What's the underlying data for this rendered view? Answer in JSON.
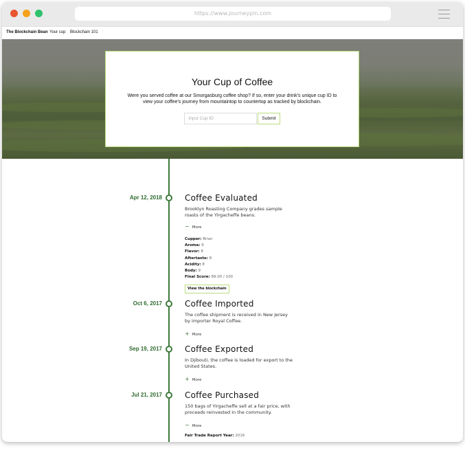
{
  "browser": {
    "url": "https://www.journeypin.com"
  },
  "nav": {
    "brand": "The Blockchain Bean",
    "links": [
      "Your cup",
      "Blockchain 101"
    ]
  },
  "hero": {
    "title": "Your Cup of Coffee",
    "description": "Were you served coffee at our Smorgasburg coffee shop? If so, enter your drink's unique cup ID to view your coffee's journey from mountaintop to countertop as tracked by blockchain.",
    "input_placeholder": "Input Cup ID",
    "submit_label": "Submit"
  },
  "colors": {
    "accent": "#3d7a3b",
    "border_accent": "#b9dc7c"
  },
  "timeline": [
    {
      "date": "Apr 12, 2018",
      "title": "Coffee Evaluated",
      "description": "Brooklyn Roasting Company grades sample roasts of the Yirgacheffe beans.",
      "toggle_sign": "−",
      "toggle_label": "More",
      "details": [
        {
          "key": "Cupper:",
          "value": "Brian"
        },
        {
          "key": "Aroma:",
          "value": "9"
        },
        {
          "key": "Flavor:",
          "value": "8"
        },
        {
          "key": "Aftertaste:",
          "value": "8"
        },
        {
          "key": "Acidity:",
          "value": "8"
        },
        {
          "key": "Body:",
          "value": "9"
        },
        {
          "key": "Final Score:",
          "value": "89.00 / 100"
        }
      ],
      "button": "View the blockchain"
    },
    {
      "date": "Oct 6, 2017",
      "title": "Coffee Imported",
      "description": "The coffee shipment is received in New Jersey by importer Royal Coffee.",
      "toggle_sign": "+",
      "toggle_label": "More"
    },
    {
      "date": "Sep 19, 2017",
      "title": "Coffee Exported",
      "description": "In Djibouti, the coffee is loaded for export to the United States.",
      "toggle_sign": "+",
      "toggle_label": "More"
    },
    {
      "date": "Jul 21, 2017",
      "title": "Coffee Purchased",
      "description": "150 bags of Yirgacheffe sell at a fair price, with proceeds reinvested in the community.",
      "toggle_sign": "−",
      "toggle_label": "More",
      "details": [
        {
          "key": "Fair Trade Report Year:",
          "value": "2016"
        }
      ]
    }
  ]
}
